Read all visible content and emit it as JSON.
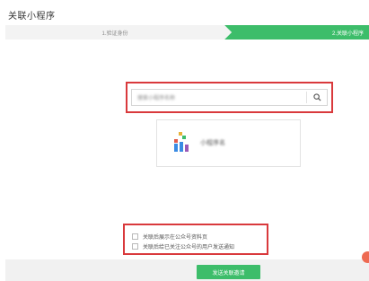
{
  "page": {
    "title": "关联小程序"
  },
  "steps": [
    {
      "label": "1.验证身份"
    },
    {
      "label": "2.关联小程序"
    }
  ],
  "search": {
    "value": "搜索小程序名称",
    "icon": "search-icon"
  },
  "result": {
    "name": "小程序名",
    "logo_colors": [
      "#e8b23a",
      "#3dbd6a",
      "#e25b4b",
      "#3a8be3",
      "#9b59b6"
    ]
  },
  "options": [
    {
      "label": "关联后展示在公众号资料页"
    },
    {
      "label": "关联后给已关注公众号的用户发送通知"
    }
  ],
  "actions": {
    "send_label": "发送关联邀请"
  },
  "colors": {
    "accent": "#3dbd6a",
    "highlight": "#d9393c"
  }
}
